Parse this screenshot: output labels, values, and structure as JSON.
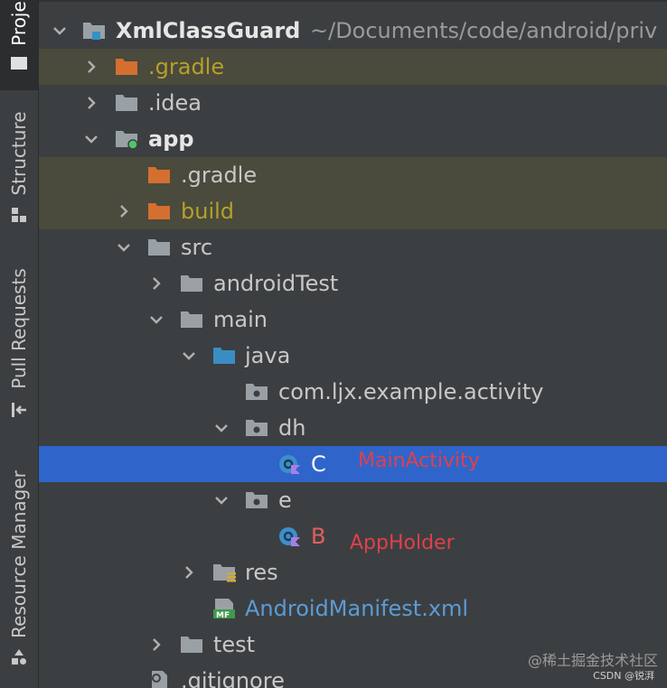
{
  "tool_strip": {
    "tabs": [
      {
        "label": "Proje",
        "active": true
      },
      {
        "label": "Structure"
      },
      {
        "label": "Pull Requests"
      },
      {
        "label": "Resource Manager"
      }
    ]
  },
  "project": {
    "name": "XmlClassGuard",
    "path": "~/Documents/code/android/priv"
  },
  "tree": [
    {
      "label": ".gradle",
      "expanded": false,
      "icon": "folder-orange-icon",
      "style": "orange"
    },
    {
      "label": ".idea",
      "expanded": false,
      "icon": "folder-icon"
    },
    {
      "label": "app",
      "expanded": true,
      "icon": "module-folder-icon",
      "style": "bold"
    },
    {
      "label": ".gradle",
      "icon": "folder-orange-icon"
    },
    {
      "label": "build",
      "expanded": false,
      "icon": "folder-orange-icon",
      "style": "orange"
    },
    {
      "label": "src",
      "expanded": true,
      "icon": "folder-icon"
    },
    {
      "label": "androidTest",
      "expanded": false,
      "icon": "folder-icon"
    },
    {
      "label": "main",
      "expanded": true,
      "icon": "folder-icon"
    },
    {
      "label": "java",
      "expanded": true,
      "icon": "source-folder-icon"
    },
    {
      "label": "com.ljx.example.activity",
      "icon": "package-icon"
    },
    {
      "label": "dh",
      "expanded": true,
      "icon": "package-icon"
    },
    {
      "label": "C",
      "icon": "kotlin-class-icon",
      "selected": true
    },
    {
      "label": "e",
      "expanded": true,
      "icon": "package-icon"
    },
    {
      "label": "B",
      "icon": "kotlin-class-icon",
      "style": "red"
    },
    {
      "label": "res",
      "expanded": false,
      "icon": "resource-folder-icon"
    },
    {
      "label": "AndroidManifest.xml",
      "icon": "manifest-icon",
      "style": "blue"
    },
    {
      "label": "test",
      "expanded": false,
      "icon": "folder-icon"
    },
    {
      "label": ".gitignore",
      "icon": "gitignore-icon"
    }
  ],
  "annotations": {
    "c_note": "MainActivity",
    "b_note": "AppHolder"
  },
  "watermark": {
    "line1": "@稀土掘金技术社区",
    "line2": "CSDN @锐湃"
  },
  "colors": {
    "background": "#3c3f41",
    "selection": "#2f65ca",
    "annotation": "#e0404a"
  }
}
